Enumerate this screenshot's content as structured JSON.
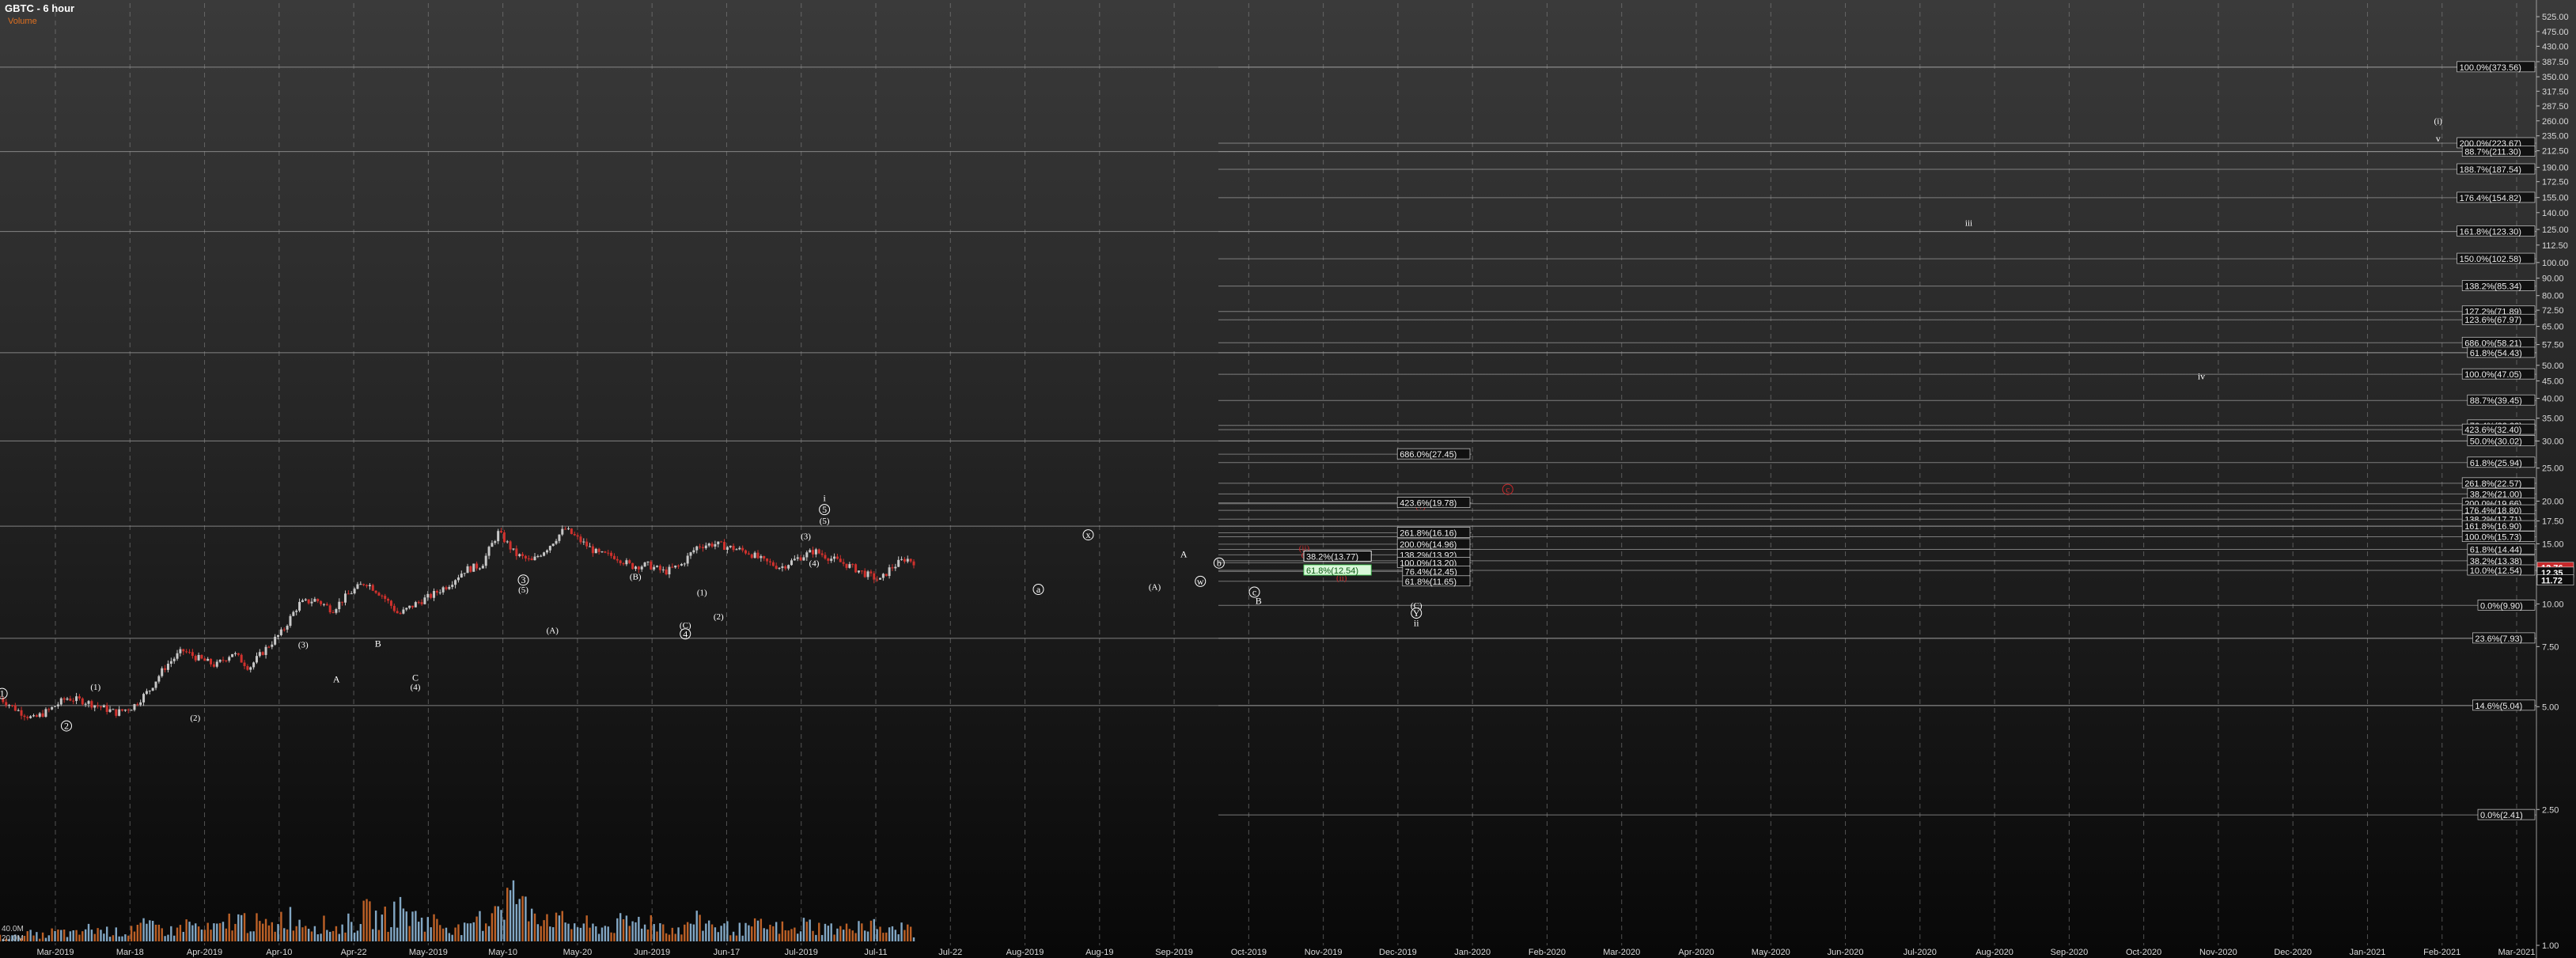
{
  "header": {
    "title": "GBTC - 6 hour",
    "subtitle": "Volume"
  },
  "chart_data": {
    "type": "candlestick",
    "symbol": "GBTC",
    "interval": "6 hour",
    "y_scale": "log",
    "ylim": [
      1.0,
      575
    ],
    "y_ticks": [
      "525.00",
      "475.00",
      "430.00",
      "387.50",
      "350.00",
      "317.50",
      "287.50",
      "260.00",
      "235.00",
      "212.50",
      "190.00",
      "172.50",
      "155.00",
      "140.00",
      "125.00",
      "112.50",
      "100.00",
      "90.00",
      "80.00",
      "72.50",
      "65.00",
      "57.50",
      "50.00",
      "45.00",
      "40.00",
      "35.00",
      "30.00",
      "25.00",
      "20.00",
      "17.50",
      "15.00",
      "12.50",
      "10.00",
      "7.50",
      "5.00",
      "2.50",
      "1.00"
    ],
    "x_ticks": [
      "Mar-2019",
      "Mar-18",
      "Apr-2019",
      "Apr-10",
      "Apr-22",
      "May-2019",
      "May-10",
      "May-20",
      "Jun-2019",
      "Jun-17",
      "Jul-2019",
      "Jul-11",
      "Jul-22",
      "Aug-2019",
      "Aug-19",
      "Sep-2019",
      "Oct-2019",
      "Nov-2019",
      "Dec-2019",
      "Jan-2020",
      "Feb-2020",
      "Mar-2020",
      "Apr-2020",
      "May-2020",
      "Jun-2020",
      "Jul-2020",
      "Aug-2020",
      "Sep-2020",
      "Oct-2020",
      "Nov-2020",
      "Dec-2020",
      "Jan-2021",
      "Feb-2021",
      "Mar-2021"
    ],
    "price_path": [
      [
        0,
        5.3
      ],
      [
        0.4,
        4.9
      ],
      [
        0.8,
        4.6
      ],
      [
        1.2,
        4.9
      ],
      [
        1.6,
        5.3
      ],
      [
        2.0,
        5.2
      ],
      [
        2.4,
        5.0
      ],
      [
        2.8,
        4.8
      ],
      [
        3.2,
        5.0
      ],
      [
        3.6,
        5.6
      ],
      [
        4.0,
        6.6
      ],
      [
        4.4,
        7.3
      ],
      [
        4.8,
        6.9
      ],
      [
        5.2,
        6.6
      ],
      [
        5.6,
        7.2
      ],
      [
        6.0,
        6.5
      ],
      [
        6.4,
        7.4
      ],
      [
        6.8,
        8.3
      ],
      [
        7.2,
        10.0
      ],
      [
        7.6,
        10.3
      ],
      [
        8.0,
        9.6
      ],
      [
        8.4,
        10.7
      ],
      [
        8.8,
        11.6
      ],
      [
        9.2,
        10.6
      ],
      [
        9.6,
        9.3
      ],
      [
        10.0,
        10.0
      ],
      [
        10.4,
        10.6
      ],
      [
        10.8,
        11.4
      ],
      [
        11.2,
        12.6
      ],
      [
        11.6,
        13.0
      ],
      [
        12.0,
        16.2
      ],
      [
        12.4,
        14.0
      ],
      [
        12.8,
        13.3
      ],
      [
        13.2,
        14.7
      ],
      [
        13.6,
        16.6
      ],
      [
        14.0,
        15.2
      ],
      [
        14.4,
        14.0
      ],
      [
        14.8,
        13.8
      ],
      [
        15.2,
        12.9
      ],
      [
        15.6,
        13.0
      ],
      [
        16.0,
        12.4
      ],
      [
        16.4,
        13.0
      ],
      [
        16.8,
        14.8
      ],
      [
        17.2,
        15.0
      ],
      [
        17.6,
        14.6
      ],
      [
        18.0,
        14.2
      ],
      [
        18.4,
        13.3
      ],
      [
        18.8,
        12.8
      ],
      [
        19.2,
        13.6
      ],
      [
        19.6,
        14.3
      ],
      [
        20.0,
        13.6
      ],
      [
        20.4,
        13.0
      ],
      [
        20.8,
        12.3
      ],
      [
        21.2,
        11.7
      ],
      [
        21.4,
        12.6
      ],
      [
        21.8,
        13.6
      ],
      [
        22.0,
        13.3
      ]
    ],
    "volume": [
      0.3,
      0.5,
      0.4,
      0.6,
      0.5,
      0.8,
      0.7,
      0.6,
      1.0,
      0.9,
      0.7,
      1.1,
      0.8,
      0.9,
      1.4,
      1.2,
      1.0,
      1.6,
      1.3,
      1.1,
      0.9,
      1.2,
      1.8,
      1.5,
      2.0,
      1.6,
      1.3,
      1.0,
      0.8,
      1.4,
      2.6,
      3.0,
      2.2,
      1.7,
      1.3,
      1.1,
      0.9,
      1.0,
      1.2,
      1.4,
      1.1,
      0.8,
      1.3,
      1.2,
      0.9,
      0.8,
      1.0,
      0.9,
      0.7,
      1.1,
      0.9,
      0.8,
      1.2,
      1.0,
      0.7,
      0.9,
      0.6
    ],
    "volume_scale_labels": [
      "40.0M",
      "20.0M"
    ],
    "last_prices": [
      {
        "value": 12.76,
        "label": "12.76",
        "color": "#c8282a"
      },
      {
        "value": 12.35,
        "label": "12.35",
        "color": "#ffffff"
      },
      {
        "value": 11.72,
        "label": "11.72",
        "color": "#ffffff"
      }
    ],
    "right_fib_levels": [
      {
        "value": 373.56,
        "label": "100.0%(373.56)"
      },
      {
        "value": 223.67,
        "label": "200.0%(223.67)"
      },
      {
        "value": 211.3,
        "label": "88.7%(211.30)"
      },
      {
        "value": 187.54,
        "label": "188.7%(187.54)"
      },
      {
        "value": 154.82,
        "label": "176.4%(154.82)"
      },
      {
        "value": 123.3,
        "label": "161.8%(123.30)"
      },
      {
        "value": 102.58,
        "label": "150.0%(102.58)"
      },
      {
        "value": 85.34,
        "label": "138.2%(85.34)"
      },
      {
        "value": 71.89,
        "label": "127.2%(71.89)"
      },
      {
        "value": 67.97,
        "label": "123.6%(67.97)"
      },
      {
        "value": 58.21,
        "label": "686.0%(58.21)"
      },
      {
        "value": 54.43,
        "label": "61.8%(54.43)"
      },
      {
        "value": 47.05,
        "label": "100.0%(47.05)"
      },
      {
        "value": 39.45,
        "label": "88.7%(39.45)"
      },
      {
        "value": 33.33,
        "label": "76.4%(33.33)"
      },
      {
        "value": 32.4,
        "label": "423.6%(32.40)"
      },
      {
        "value": 30.02,
        "label": "50.0%(30.02)"
      },
      {
        "value": 25.94,
        "label": "61.8%(25.94)"
      },
      {
        "value": 22.57,
        "label": "261.8%(22.57)"
      },
      {
        "value": 21.0,
        "label": "38.2%(21.00)"
      },
      {
        "value": 19.66,
        "label": "200.0%(19.66)"
      },
      {
        "value": 18.8,
        "label": "176.4%(18.80)"
      },
      {
        "value": 17.71,
        "label": "138.2%(17.71)"
      },
      {
        "value": 16.9,
        "label": "161.8%(16.90)"
      },
      {
        "value": 15.73,
        "label": "100.0%(15.73)"
      },
      {
        "value": 14.44,
        "label": "61.8%(14.44)"
      },
      {
        "value": 13.38,
        "label": "38.2%(13.38)"
      },
      {
        "value": 12.54,
        "label": "10.0%(12.54)"
      },
      {
        "value": 9.9,
        "label": "0.0%(9.90)"
      },
      {
        "value": 7.93,
        "label": "23.6%(7.93)"
      },
      {
        "value": 5.04,
        "label": "14.6%(5.04)"
      },
      {
        "value": 2.41,
        "label": "0.0%(2.41)"
      }
    ],
    "mid_fib_levels": [
      {
        "value": 27.45,
        "label": "686.0%(27.45)"
      },
      {
        "value": 19.78,
        "label": "423.6%(19.78)"
      },
      {
        "value": 16.16,
        "label": "261.8%(16.16)"
      },
      {
        "value": 14.96,
        "label": "200.0%(14.96)"
      },
      {
        "value": 13.92,
        "label": "138.2%(13.92)"
      },
      {
        "value": 13.2,
        "label": "100.0%(13.20)"
      },
      {
        "value": 12.45,
        "label": "76.4%(12.45)"
      },
      {
        "value": 11.65,
        "label": "61.8%(11.65)"
      }
    ],
    "inner_fib_labels": [
      {
        "value": 13.77,
        "label": "38.2%(13.77)",
        "color": "#ffffff"
      },
      {
        "value": 12.54,
        "label": "61.8%(12.54)",
        "color": "#44cc55"
      }
    ],
    "long_horizontal_lines": [
      373.56,
      211.3,
      123.3,
      54.43,
      30.02,
      16.9,
      7.93,
      5.04
    ],
    "wave_labels": [
      {
        "text": "1",
        "x": 0.05,
        "y": 5.35,
        "circled": true,
        "color": "#ffffff"
      },
      {
        "text": "2",
        "x": 1.6,
        "y": 4.3,
        "circled": true,
        "color": "#ffffff"
      },
      {
        "text": "(1)",
        "x": 2.3,
        "y": 5.6,
        "circled": false,
        "color": "#ffffff"
      },
      {
        "text": "(2)",
        "x": 4.7,
        "y": 4.55,
        "circled": false,
        "color": "#ffffff"
      },
      {
        "text": "(3)",
        "x": 7.3,
        "y": 7.45,
        "circled": false,
        "color": "#ffffff"
      },
      {
        "text": "A",
        "x": 8.1,
        "y": 5.9,
        "circled": false,
        "color": "#ffffff"
      },
      {
        "text": "B",
        "x": 9.1,
        "y": 7.5,
        "circled": false,
        "color": "#ffffff"
      },
      {
        "text": "C",
        "x": 10.0,
        "y": 5.95,
        "circled": false,
        "color": "#ffffff"
      },
      {
        "text": "(4)",
        "x": 10.0,
        "y": 5.6,
        "circled": false,
        "color": "#ffffff"
      },
      {
        "text": "(5)",
        "x": 12.6,
        "y": 10.8,
        "circled": false,
        "color": "#ffffff"
      },
      {
        "text": "3",
        "x": 12.6,
        "y": 11.5,
        "circled": true,
        "color": "#ffffff"
      },
      {
        "text": "(A)",
        "x": 13.3,
        "y": 8.2,
        "circled": false,
        "color": "#ffffff"
      },
      {
        "text": "(B)",
        "x": 15.3,
        "y": 11.8,
        "circled": false,
        "color": "#ffffff"
      },
      {
        "text": "(C)",
        "x": 16.5,
        "y": 8.5,
        "circled": false,
        "color": "#ffffff"
      },
      {
        "text": "4",
        "x": 16.5,
        "y": 8.0,
        "circled": true,
        "color": "#ffffff"
      },
      {
        "text": "(1)",
        "x": 16.9,
        "y": 10.6,
        "circled": false,
        "color": "#ffffff"
      },
      {
        "text": "(2)",
        "x": 17.3,
        "y": 9.0,
        "circled": false,
        "color": "#ffffff"
      },
      {
        "text": "(3)",
        "x": 19.4,
        "y": 15.5,
        "circled": false,
        "color": "#ffffff"
      },
      {
        "text": "(4)",
        "x": 19.6,
        "y": 12.9,
        "circled": false,
        "color": "#ffffff"
      },
      {
        "text": "(5)",
        "x": 19.85,
        "y": 17.2,
        "circled": false,
        "color": "#ffffff"
      },
      {
        "text": "5",
        "x": 19.85,
        "y": 18.5,
        "circled": true,
        "color": "#ffffff"
      },
      {
        "text": "i",
        "x": 19.85,
        "y": 20.0,
        "circled": false,
        "color": "#ffffff"
      },
      {
        "text": "a",
        "x": 25.0,
        "y": 10.8,
        "circled": true,
        "color": "#ffffff"
      },
      {
        "text": "x",
        "x": 26.2,
        "y": 15.6,
        "circled": true,
        "color": "#ffffff"
      },
      {
        "text": "(A)",
        "x": 27.8,
        "y": 11.0,
        "circled": false,
        "color": "#ffffff"
      },
      {
        "text": "A",
        "x": 28.5,
        "y": 13.7,
        "circled": false,
        "color": "#ffffff"
      },
      {
        "text": "w",
        "x": 28.9,
        "y": 11.4,
        "circled": true,
        "color": "#ffffff"
      },
      {
        "text": "b",
        "x": 29.35,
        "y": 12.9,
        "circled": true,
        "color": "#ffffff"
      },
      {
        "text": "c",
        "x": 30.2,
        "y": 10.6,
        "circled": true,
        "color": "#ffffff"
      },
      {
        "text": "B",
        "x": 30.3,
        "y": 10.0,
        "circled": false,
        "color": "#ffffff"
      },
      {
        "text": "(ii)",
        "x": 31.4,
        "y": 14.3,
        "circled": false,
        "color": "#c8282a"
      },
      {
        "text": "C",
        "x": 31.4,
        "y": 13.6,
        "circled": false,
        "color": "#c8282a"
      },
      {
        "text": "(ii)",
        "x": 32.3,
        "y": 11.7,
        "circled": false,
        "color": "#c8282a"
      },
      {
        "text": "(iv)",
        "x": 35.2,
        "y": 14.1,
        "circled": false,
        "color": "#c8282a"
      },
      {
        "text": "(v)",
        "x": 34.2,
        "y": 19.0,
        "circled": false,
        "color": "#c8282a"
      },
      {
        "text": "c",
        "x": 36.3,
        "y": 21.2,
        "circled": true,
        "color": "#c8282a"
      },
      {
        "text": "(C)",
        "x": 34.1,
        "y": 9.7,
        "circled": false,
        "color": "#ffffff"
      },
      {
        "text": "Y",
        "x": 34.1,
        "y": 9.2,
        "circled": true,
        "color": "#ffffff"
      },
      {
        "text": "ii",
        "x": 34.1,
        "y": 8.6,
        "circled": false,
        "color": "#ffffff"
      },
      {
        "text": "iii",
        "x": 47.4,
        "y": 128,
        "circled": false,
        "color": "#ffffff"
      },
      {
        "text": "iv",
        "x": 53.0,
        "y": 45.5,
        "circled": false,
        "color": "#ffffff"
      },
      {
        "text": "(i)",
        "x": 58.7,
        "y": 255,
        "circled": false,
        "color": "#ffffff"
      },
      {
        "text": "v",
        "x": 58.7,
        "y": 226,
        "circled": false,
        "color": "#ffffff"
      }
    ]
  }
}
